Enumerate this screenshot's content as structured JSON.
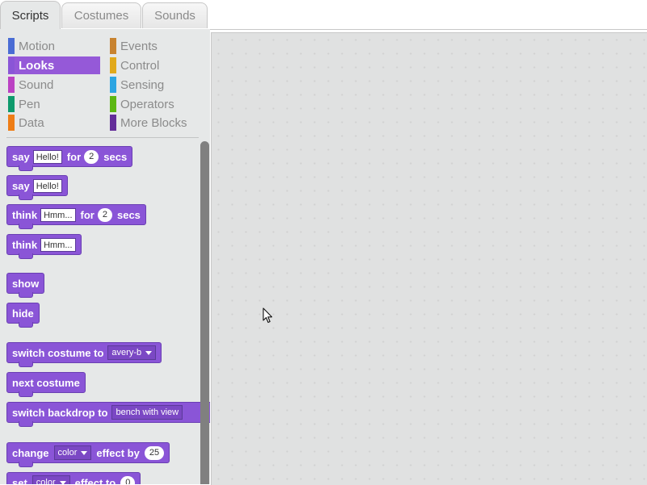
{
  "tabs": [
    {
      "label": "Scripts",
      "active": true
    },
    {
      "label": "Costumes",
      "active": false
    },
    {
      "label": "Sounds",
      "active": false
    }
  ],
  "categories": [
    {
      "label": "Motion",
      "color": "#4a6cd4"
    },
    {
      "label": "Looks",
      "color": "#8a55d7",
      "selected": true
    },
    {
      "label": "Sound",
      "color": "#bb42c3"
    },
    {
      "label": "Pen",
      "color": "#0e9a6c"
    },
    {
      "label": "Data",
      "color": "#ee7d16"
    },
    {
      "label": "Events",
      "color": "#c88330"
    },
    {
      "label": "Control",
      "color": "#e1a91a"
    },
    {
      "label": "Sensing",
      "color": "#2ca5e2"
    },
    {
      "label": "Operators",
      "color": "#5cb712"
    },
    {
      "label": "More Blocks",
      "color": "#632d99"
    }
  ],
  "blocks": {
    "say_for": {
      "w1": "say",
      "text": "Hello!",
      "w2": "for",
      "num": "2",
      "w3": "secs"
    },
    "say": {
      "w1": "say",
      "text": "Hello!"
    },
    "think_for": {
      "w1": "think",
      "text": "Hmm...",
      "w2": "for",
      "num": "2",
      "w3": "secs"
    },
    "think": {
      "w1": "think",
      "text": "Hmm..."
    },
    "show": {
      "w1": "show"
    },
    "hide": {
      "w1": "hide"
    },
    "switch_costume": {
      "w1": "switch costume to",
      "dropdown": "avery-b"
    },
    "next_costume": {
      "w1": "next costume"
    },
    "switch_backdrop": {
      "w1": "switch backdrop to",
      "dropdown": "bench with view"
    },
    "change_effect": {
      "w1": "change",
      "dropdown": "color",
      "w2": "effect by",
      "num": "25"
    },
    "set_effect": {
      "w1": "set",
      "dropdown": "color",
      "w2": "effect to",
      "num": "0"
    }
  },
  "icons": {
    "cursor": "mouse-pointer-icon"
  }
}
